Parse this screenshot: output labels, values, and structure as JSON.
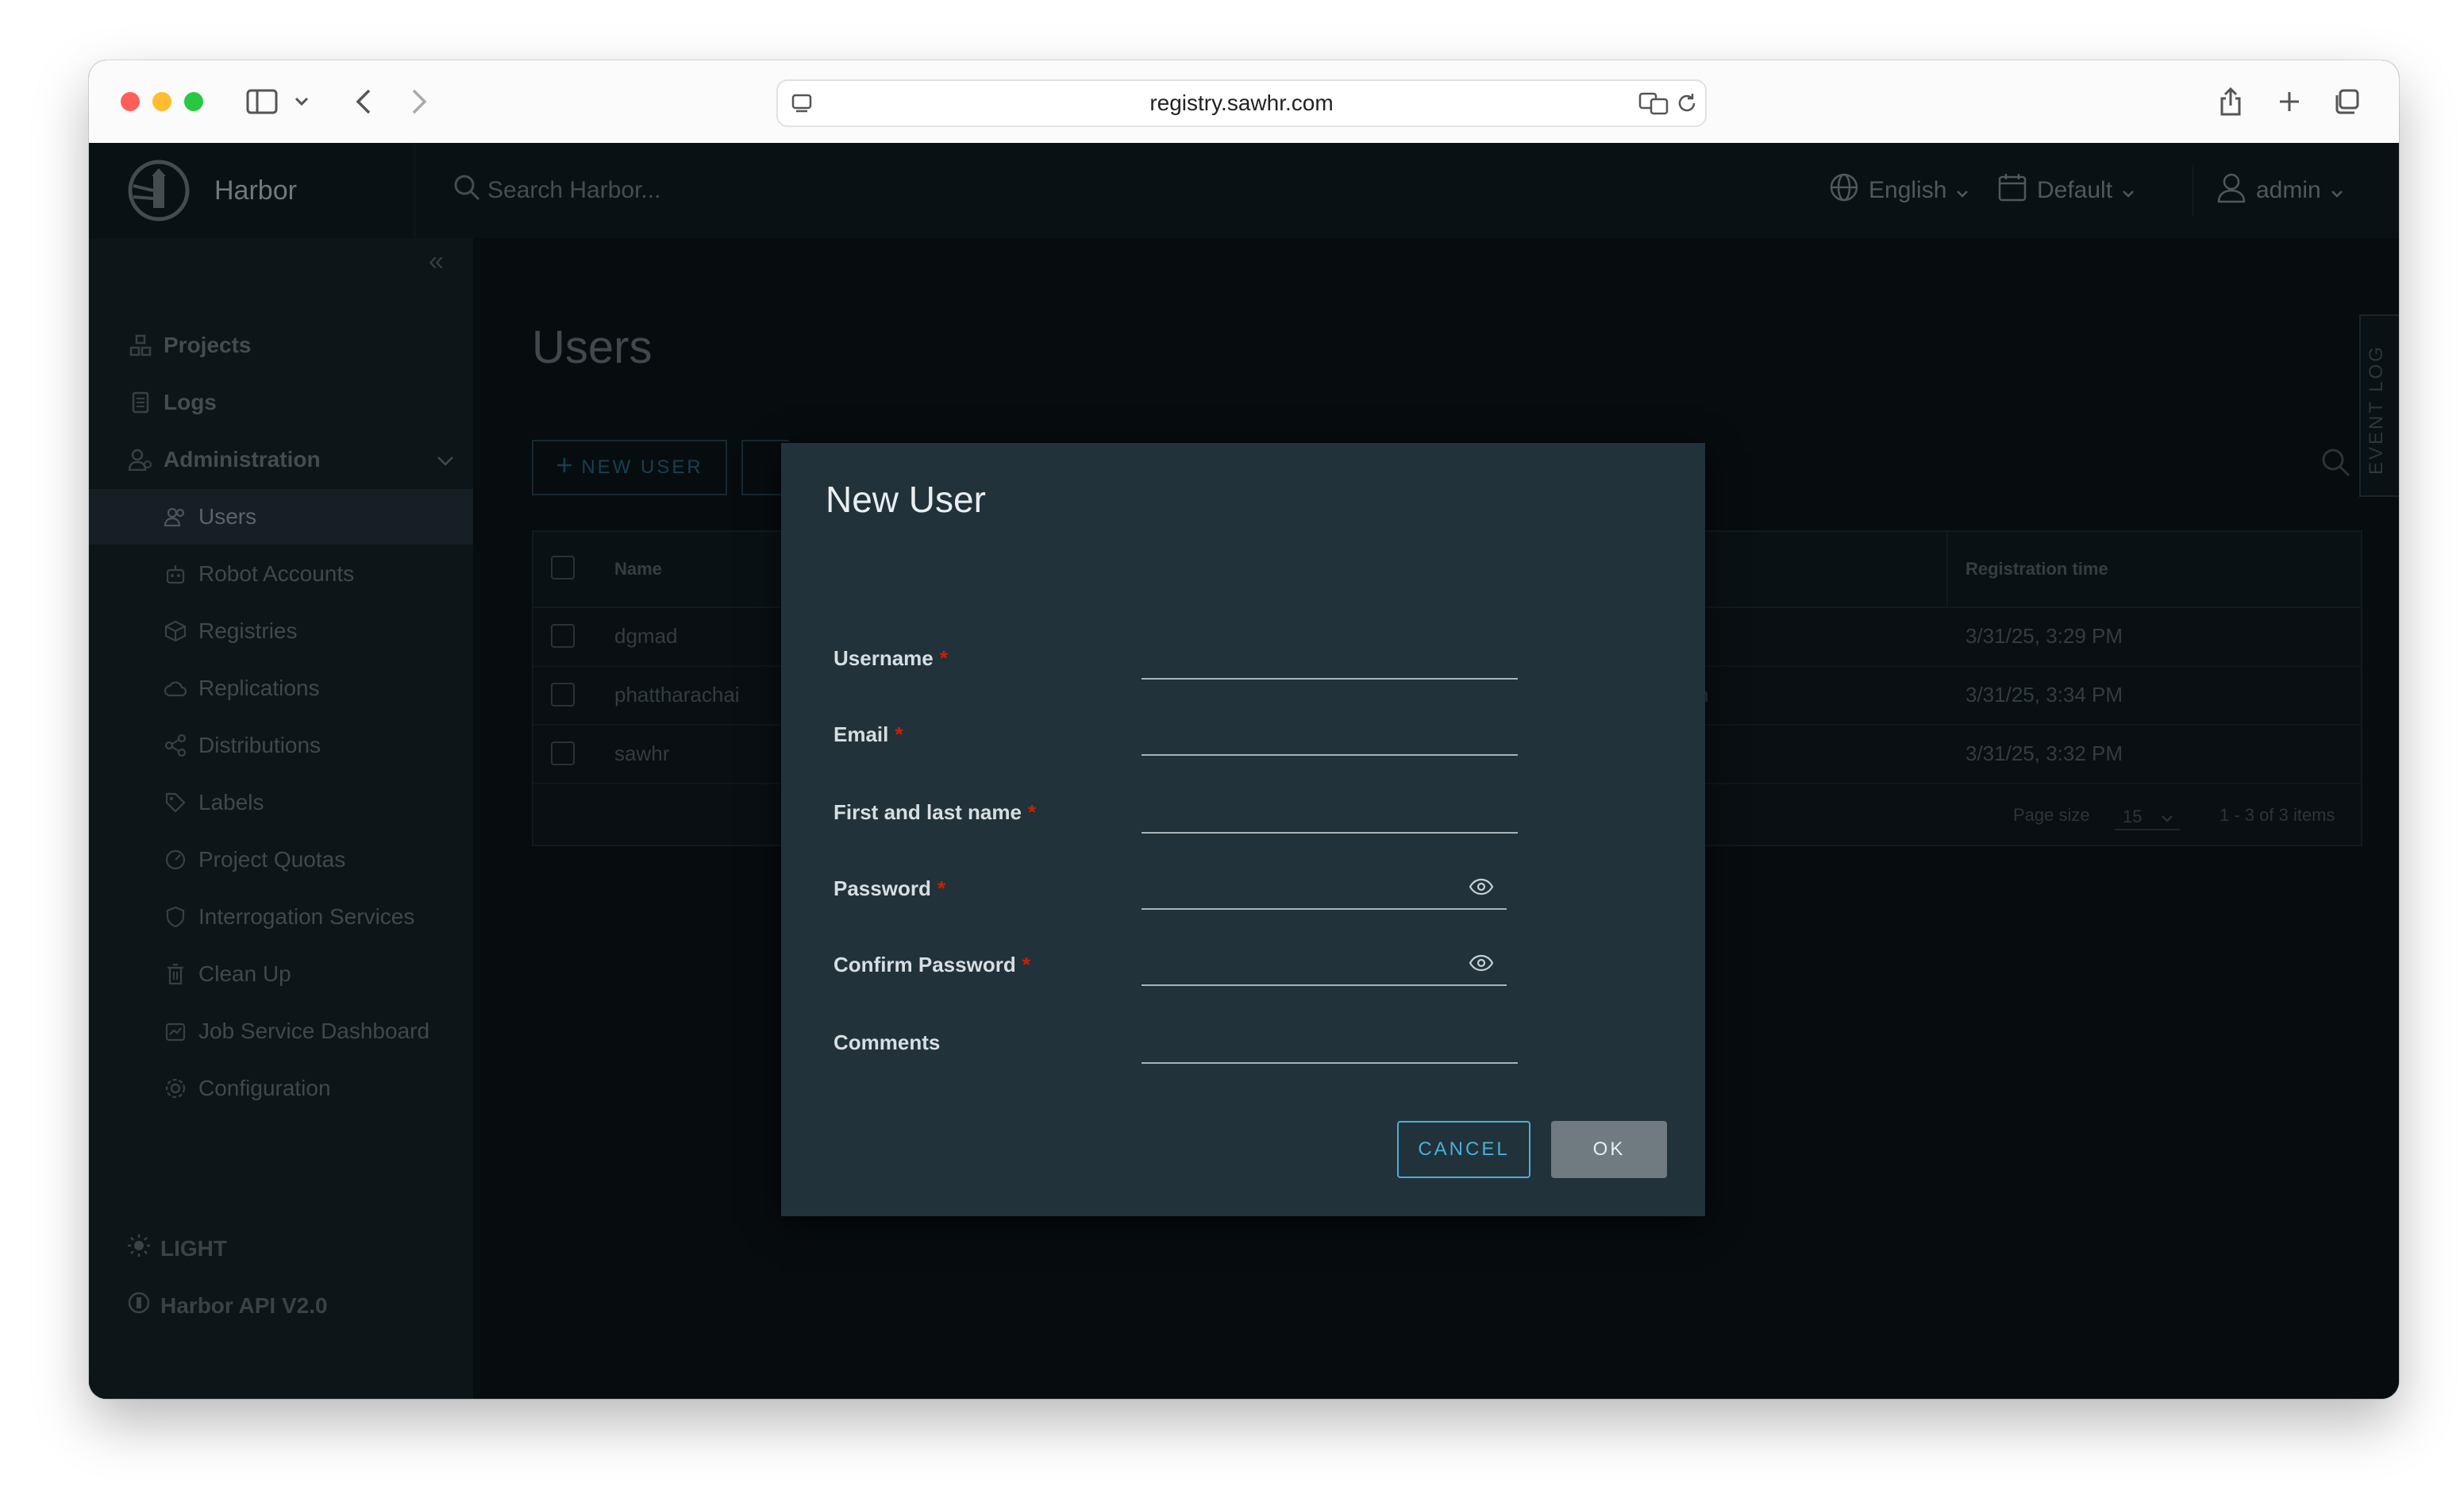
{
  "browser": {
    "url": "registry.sawhr.com"
  },
  "header": {
    "brand": "Harbor",
    "search_placeholder": "Search Harbor...",
    "language": "English",
    "theme_select": "Default",
    "user": "admin"
  },
  "sidebar": {
    "items": [
      {
        "label": "Projects",
        "icon": "projects-icon"
      },
      {
        "label": "Logs",
        "icon": "logs-icon"
      },
      {
        "label": "Administration",
        "icon": "administration-icon"
      }
    ],
    "admin_items": [
      {
        "label": "Users"
      },
      {
        "label": "Robot Accounts"
      },
      {
        "label": "Registries"
      },
      {
        "label": "Replications"
      },
      {
        "label": "Distributions"
      },
      {
        "label": "Labels"
      },
      {
        "label": "Project Quotas"
      },
      {
        "label": "Interrogation Services"
      },
      {
        "label": "Clean Up"
      },
      {
        "label": "Job Service Dashboard"
      },
      {
        "label": "Configuration"
      }
    ],
    "theme_toggle": "LIGHT",
    "api_link": "Harbor API V2.0"
  },
  "main": {
    "title": "Users",
    "new_user_button": "NEW USER",
    "columns": {
      "name": "Name",
      "registration_time": "Registration time"
    },
    "rows": [
      {
        "name": "dgmad",
        "registration_time": "3/31/25, 3:29 PM"
      },
      {
        "name": "phattharachai",
        "registration_time": "3/31/25, 3:34 PM",
        "fragment": "n"
      },
      {
        "name": "sawhr",
        "registration_time": "3/31/25, 3:32 PM"
      }
    ],
    "page_size_label": "Page size",
    "page_size_value": "15",
    "pagination": "1 - 3 of 3 items",
    "event_log": "EVENT LOG"
  },
  "modal": {
    "title": "New User",
    "fields": {
      "username": {
        "label": "Username",
        "required": "*",
        "value": ""
      },
      "email": {
        "label": "Email",
        "required": "*",
        "value": ""
      },
      "fullname": {
        "label": "First and last name",
        "required": "*",
        "value": ""
      },
      "password": {
        "label": "Password",
        "required": "*",
        "value": ""
      },
      "confirm_password": {
        "label": "Confirm Password",
        "required": "*",
        "value": ""
      },
      "comments": {
        "label": "Comments",
        "value": ""
      }
    },
    "cancel_button": "CANCEL",
    "ok_button": "OK"
  },
  "colors": {
    "accent": "#49afd9",
    "required": "#c92100",
    "modal_bg": "#21323a"
  }
}
